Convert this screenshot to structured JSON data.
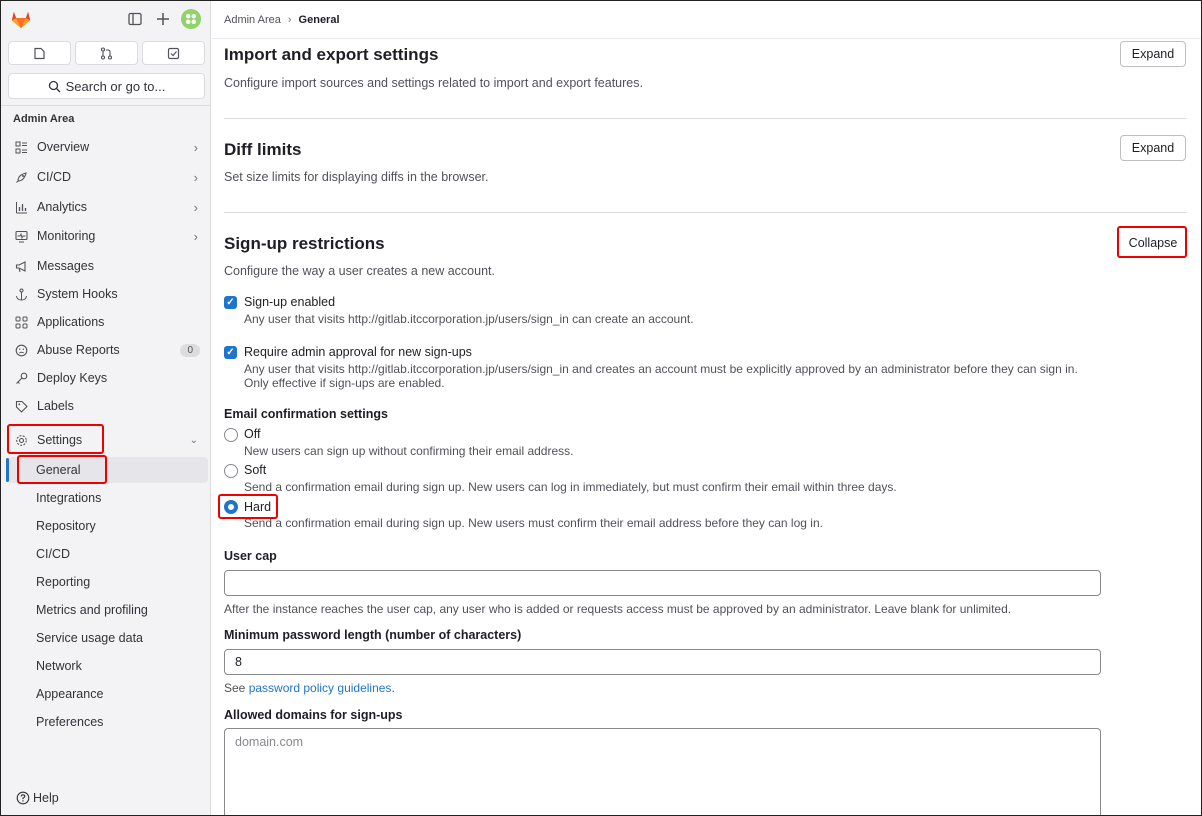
{
  "sidebar": {
    "search_label": "Search or go to...",
    "section_title": "Admin Area",
    "items": [
      {
        "label": "Overview",
        "icon": "overview-icon"
      },
      {
        "label": "CI/CD",
        "icon": "rocket-icon"
      },
      {
        "label": "Analytics",
        "icon": "chart-icon"
      },
      {
        "label": "Monitoring",
        "icon": "monitor-icon"
      },
      {
        "label": "Messages",
        "icon": "megaphone-icon"
      },
      {
        "label": "System Hooks",
        "icon": "anchor-icon"
      },
      {
        "label": "Applications",
        "icon": "grid-icon"
      },
      {
        "label": "Abuse Reports",
        "icon": "abuse-icon",
        "count": "0"
      },
      {
        "label": "Deploy Keys",
        "icon": "key-icon"
      },
      {
        "label": "Labels",
        "icon": "label-icon"
      },
      {
        "label": "Settings",
        "icon": "gear-icon"
      }
    ],
    "settings_subitems": [
      "General",
      "Integrations",
      "Repository",
      "CI/CD",
      "Reporting",
      "Metrics and profiling",
      "Service usage data",
      "Network",
      "Appearance",
      "Preferences"
    ],
    "help_label": "Help"
  },
  "breadcrumb": {
    "parent": "Admin Area",
    "current": "General"
  },
  "sections": {
    "import_export": {
      "title": "Import and export settings",
      "description": "Configure import sources and settings related to import and export features.",
      "button": "Expand"
    },
    "diff_limits": {
      "title": "Diff limits",
      "description": "Set size limits for displaying diffs in the browser.",
      "button": "Expand"
    },
    "signup": {
      "title": "Sign-up restrictions",
      "description": "Configure the way a user creates a new account.",
      "button": "Collapse",
      "signup_enabled": {
        "label": "Sign-up enabled",
        "help": "Any user that visits http://gitlab.itccorporation.jp/users/sign_in can create an account.",
        "checked": true
      },
      "admin_approval": {
        "label": "Require admin approval for new sign-ups",
        "help": "Any user that visits http://gitlab.itccorporation.jp/users/sign_in and creates an account must be explicitly approved by an administrator before they can sign in. Only effective if sign-ups are enabled.",
        "checked": true
      },
      "email_confirmation": {
        "label": "Email confirmation settings",
        "selected": "Hard",
        "options": [
          {
            "label": "Off",
            "help": "New users can sign up without confirming their email address."
          },
          {
            "label": "Soft",
            "help": "Send a confirmation email during sign up. New users can log in immediately, but must confirm their email within three days."
          },
          {
            "label": "Hard",
            "help": "Send a confirmation email during sign up. New users must confirm their email address before they can log in."
          }
        ]
      },
      "user_cap": {
        "label": "User cap",
        "value": "",
        "help": "After the instance reaches the user cap, any user who is added or requests access must be approved by an administrator. Leave blank for unlimited."
      },
      "min_password": {
        "label": "Minimum password length (number of characters)",
        "value": "8",
        "help_prefix": "See ",
        "help_link": "password policy guidelines",
        "help_suffix": "."
      },
      "allowed_domains": {
        "label": "Allowed domains for sign-ups",
        "placeholder": "domain.com"
      }
    }
  },
  "colors": {
    "accent": "#1f75cb",
    "annotation": "#e00000"
  }
}
